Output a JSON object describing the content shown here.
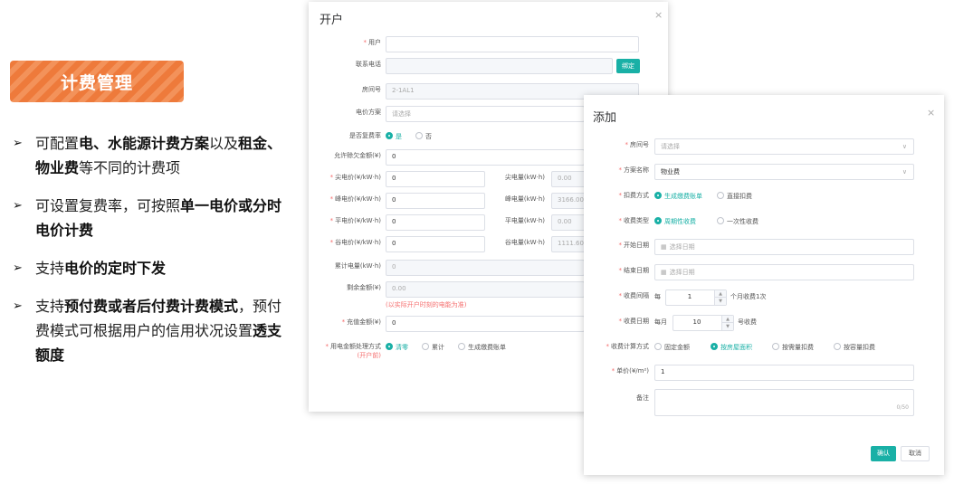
{
  "banner": {
    "title": "计费管理"
  },
  "features": [
    {
      "parts": [
        {
          "t": "可配置",
          "b": false
        },
        {
          "t": "电、水能源计费方案",
          "b": true
        },
        {
          "t": "以及",
          "b": false
        },
        {
          "t": "租金、物业费",
          "b": true
        },
        {
          "t": "等不同的计费项",
          "b": false
        }
      ]
    },
    {
      "parts": [
        {
          "t": "可设置复费率，可按照",
          "b": false
        },
        {
          "t": "单一电价或分时电价计费",
          "b": true
        }
      ]
    },
    {
      "parts": [
        {
          "t": "支持",
          "b": false
        },
        {
          "t": "电价的定时下发",
          "b": true
        }
      ]
    },
    {
      "parts": [
        {
          "t": "支持",
          "b": false
        },
        {
          "t": "预付费或者后付费计费模式",
          "b": true
        },
        {
          "t": "，预付费模式可根据用户的信用状况设置",
          "b": false
        },
        {
          "t": "透支额度",
          "b": true
        }
      ]
    }
  ],
  "bullet_glyph": "➢",
  "open_dialog": {
    "title": "开户",
    "close": "×",
    "user_label": "用户",
    "phone_label": "联系电话",
    "bind_button": "绑定",
    "room_label": "房间号",
    "room_value": "2-1AL1",
    "price_plan_label": "电价方案",
    "price_plan_placeholder": "请选择",
    "multi_rate_label": "是否复费率",
    "yes": "是",
    "no": "否",
    "overdraft_label": "允许赊欠金额(¥)",
    "overdraft_value": "0",
    "rates": [
      {
        "label": "尖电价(¥/kW·h)",
        "value": "0",
        "q_label": "尖电量(kW·h)",
        "q_value": "0.00"
      },
      {
        "label": "峰电价(¥/kW·h)",
        "value": "0",
        "q_label": "峰电量(kW·h)",
        "q_value": "3166.00"
      },
      {
        "label": "平电价(¥/kW·h)",
        "value": "0",
        "q_label": "平电量(kW·h)",
        "q_value": "0.00"
      },
      {
        "label": "谷电价(¥/kW·h)",
        "value": "0",
        "q_label": "谷电量(kW·h)",
        "q_value": "1111.60"
      }
    ],
    "cumulative_label": "累计电量(kW·h)",
    "cumulative_value": "0",
    "balance_label": "剩余金额(¥)",
    "balance_value": "0.00",
    "balance_note": "(以实际开户时刻的电能为准)",
    "recharge_label": "充值金额(¥)",
    "recharge_value": "0",
    "usage_label": "用电金额处理方式",
    "usage_sub": "(开户前)",
    "usage_options": [
      "清零",
      "累计",
      "生成缴费账单"
    ]
  },
  "add_dialog": {
    "title": "添加",
    "close": "×",
    "room_label": "房间号",
    "room_placeholder": "请选择",
    "plan_label": "方案名称",
    "plan_value": "物业费",
    "deduct_label": "扣费方式",
    "deduct_options": [
      "生成缴费账单",
      "直接扣费"
    ],
    "fee_type_label": "收费类型",
    "fee_type_options": [
      "周期性收费",
      "一次性收费"
    ],
    "start_label": "开始日期",
    "end_label": "结束日期",
    "date_placeholder": "选择日期",
    "interval_label": "收费间隔",
    "interval_prefix": "每",
    "interval_value": "1",
    "interval_suffix": "个月收费1次",
    "day_label": "收费日期",
    "day_prefix": "每月",
    "day_value": "10",
    "day_suffix": "号收费",
    "calc_label": "收费计算方式",
    "calc_options": [
      "固定金额",
      "按房屋面积",
      "按需量扣费",
      "按容量扣费"
    ],
    "unit_label": "单价(¥/m²)",
    "unit_value": "1",
    "remark_label": "备注",
    "remark_count": "0/50",
    "ok": "确认",
    "cancel": "取消"
  },
  "icons": {
    "calendar": "calendar-icon",
    "chevron": "chevron-down-icon",
    "close": "close-icon"
  },
  "colors": {
    "accent": "#19b0a6",
    "banner": "#ee7a3b",
    "required": "#f56c6c"
  }
}
